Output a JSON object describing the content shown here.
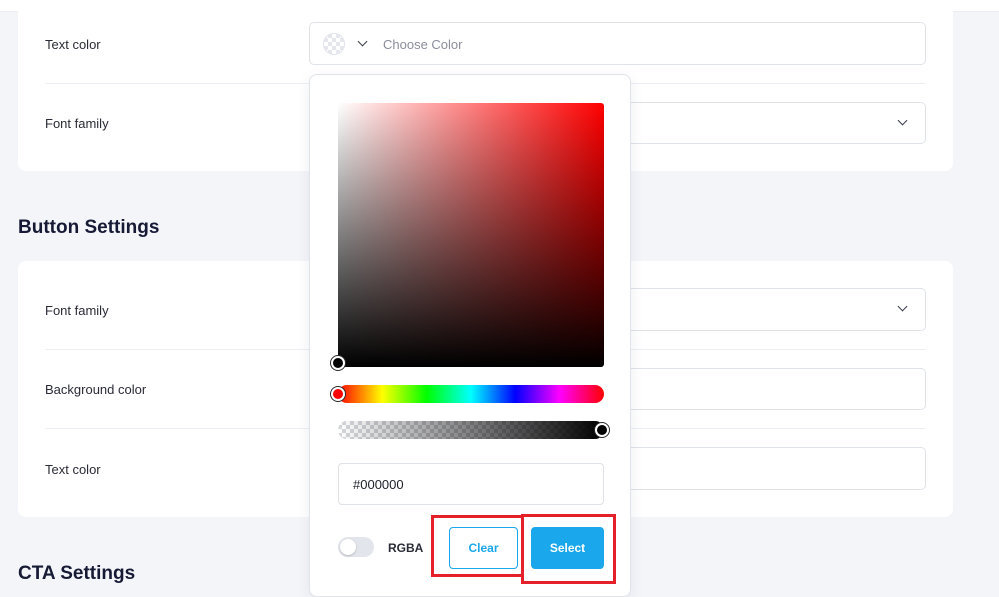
{
  "typography_card": {
    "text_color": {
      "label": "Text color",
      "placeholder": "Choose Color"
    },
    "font_family": {
      "label": "Font family"
    }
  },
  "button_settings": {
    "title": "Button Settings",
    "font_family_label": "Font family",
    "background_color_label": "Background color",
    "text_color_label": "Text color"
  },
  "cta_settings": {
    "title": "CTA Settings"
  },
  "color_picker": {
    "hue_color": "#ff0000",
    "hex_value": "#000000",
    "rgba_label": "RGBA",
    "rgba_enabled": false,
    "alpha": 1,
    "clear_label": "Clear",
    "select_label": "Select"
  },
  "colors": {
    "accent": "#1aa7ec",
    "highlight": "#e5202a",
    "page_background": "#f4f5f9"
  },
  "icons": {
    "chevron": "chevron-down-icon",
    "swatch": "transparent-swatch-icon"
  }
}
